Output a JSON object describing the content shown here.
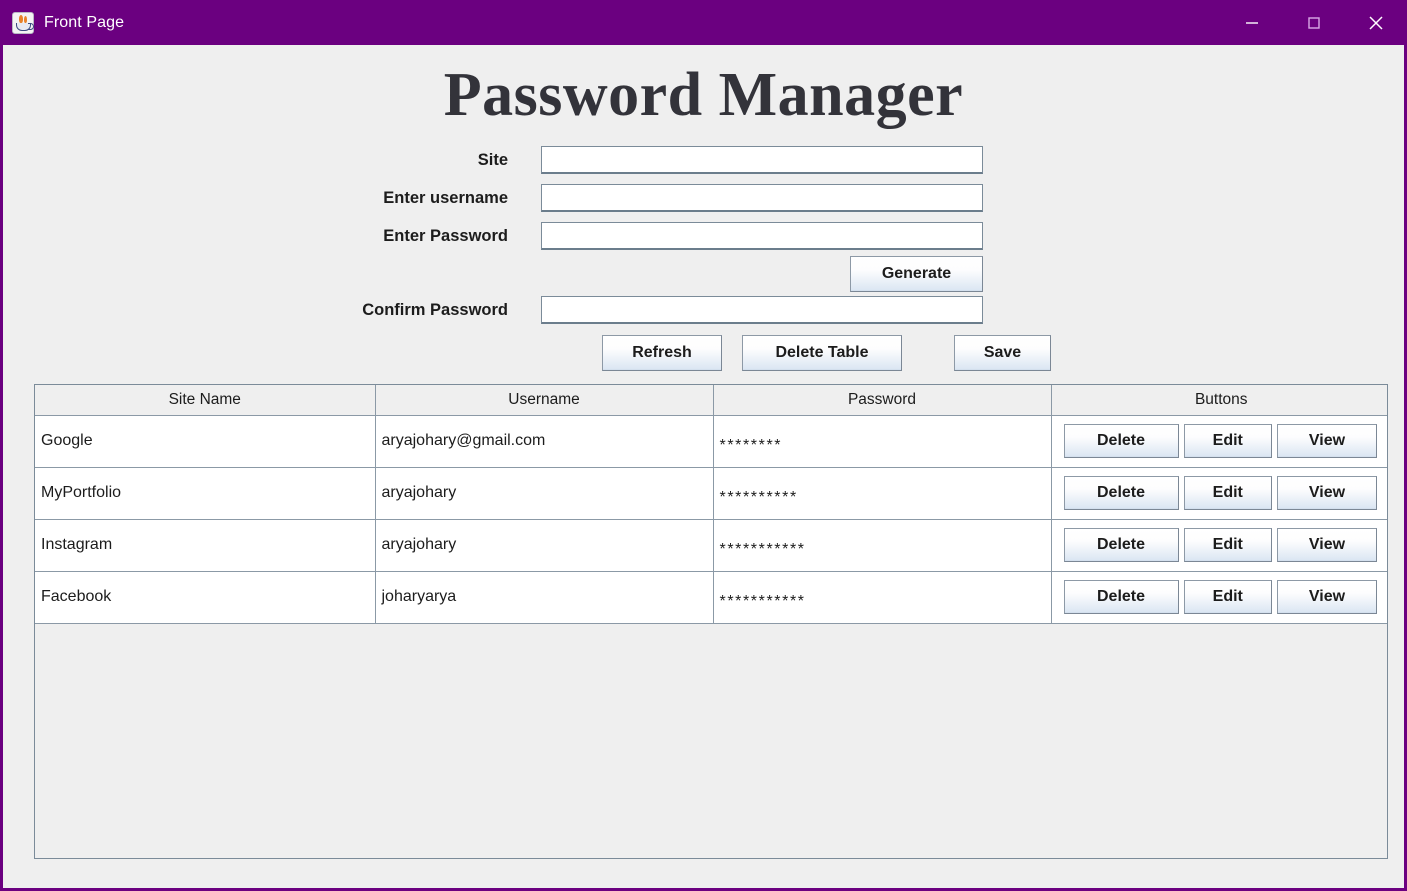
{
  "window": {
    "title": "Front Page",
    "icon": "java-coffee-cup-icon",
    "accent_color": "#6b0080",
    "background_color": "#efefef",
    "controls": {
      "minimize": "minimize-icon",
      "maximize": "maximize-icon",
      "close": "close-icon"
    }
  },
  "page": {
    "heading": "Password Manager"
  },
  "form": {
    "fields": [
      {
        "label": "Site",
        "value": "",
        "placeholder": ""
      },
      {
        "label": "Enter username",
        "value": "",
        "placeholder": ""
      },
      {
        "label": "Enter Password",
        "value": "",
        "placeholder": ""
      },
      {
        "label": "Confirm Password",
        "value": "",
        "placeholder": ""
      }
    ],
    "generate_label": "Generate"
  },
  "actions": {
    "refresh_label": "Refresh",
    "delete_table_label": "Delete Table",
    "save_label": "Save"
  },
  "table": {
    "headers": [
      "Site Name",
      "Username",
      "Password",
      "Buttons"
    ],
    "row_buttons": {
      "delete_label": "Delete",
      "edit_label": "Edit",
      "view_label": "View"
    },
    "rows": [
      {
        "site": "Google",
        "username": "aryajohary@gmail.com",
        "password_mask": "********",
        "password_length": 8
      },
      {
        "site": "MyPortfolio",
        "username": "aryajohary",
        "password_mask": "**********",
        "password_length": 10
      },
      {
        "site": "Instagram",
        "username": "aryajohary",
        "password_mask": "***********",
        "password_length": 11
      },
      {
        "site": "Facebook",
        "username": "joharyarya",
        "password_mask": "***********",
        "password_length": 11
      }
    ]
  }
}
